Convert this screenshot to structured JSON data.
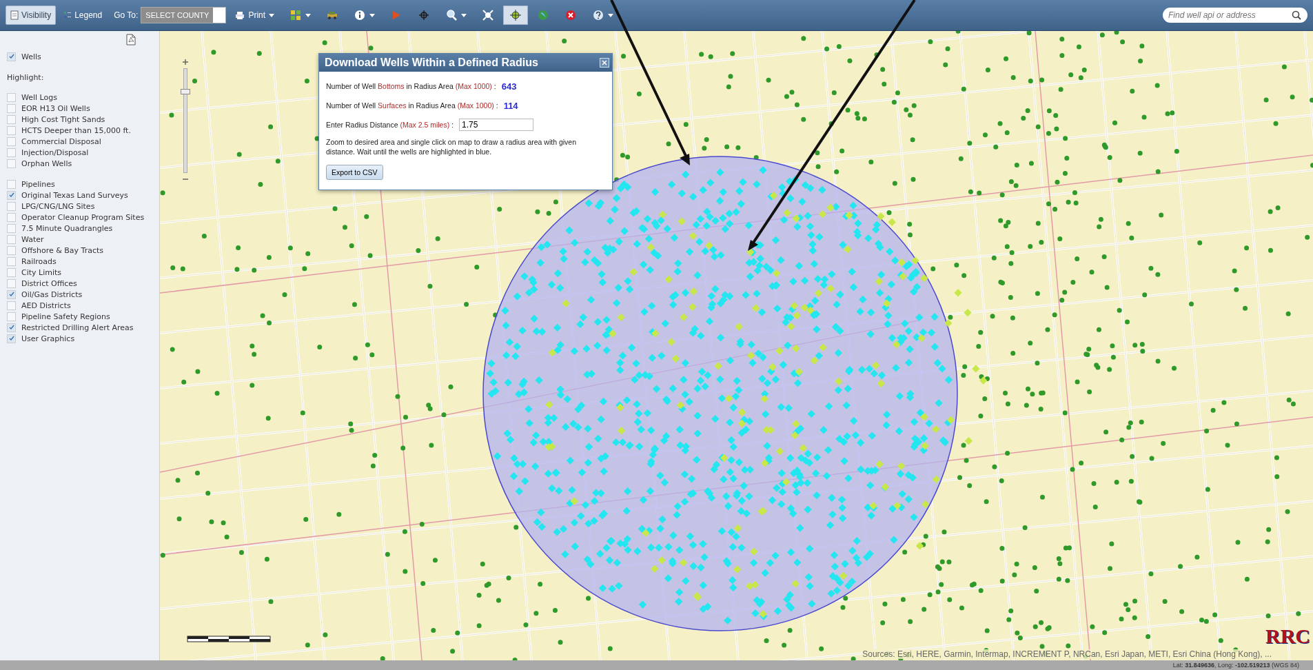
{
  "toolbar": {
    "tabs": [
      {
        "label": "Visibility",
        "selected": true
      },
      {
        "label": "Legend",
        "selected": false
      }
    ],
    "goto_label": "Go To:",
    "county_select": {
      "value": "SELECT COUNTY"
    },
    "print_button": {
      "label": "Print",
      "dropdown": true
    },
    "tools": [
      {
        "kind": "grid",
        "dropdown": true,
        "selected": false
      },
      {
        "kind": "vehicle",
        "dropdown": false,
        "selected": false
      },
      {
        "kind": "info",
        "dropdown": true,
        "selected": false
      },
      {
        "kind": "flag",
        "dropdown": false,
        "selected": false
      },
      {
        "kind": "crosshair",
        "dropdown": false,
        "selected": false
      },
      {
        "kind": "zoom",
        "dropdown": true,
        "selected": false
      },
      {
        "kind": "extent",
        "dropdown": false,
        "selected": false
      },
      {
        "kind": "locate",
        "dropdown": false,
        "selected": true
      },
      {
        "kind": "globe",
        "dropdown": false,
        "selected": false
      },
      {
        "kind": "stop",
        "dropdown": false,
        "selected": false
      },
      {
        "kind": "help",
        "dropdown": true,
        "selected": false
      }
    ],
    "search": {
      "placeholder": "Find well api or address"
    }
  },
  "sidebar": {
    "wells": {
      "label": "Wells",
      "checked": true
    },
    "highlight_label": "Highlight:",
    "highlight_items": [
      {
        "label": "Well Logs",
        "checked": false
      },
      {
        "label": "EOR H13 Oil Wells",
        "checked": false
      },
      {
        "label": "High Cost Tight Sands",
        "checked": false
      },
      {
        "label": "HCTS Deeper than 15,000 ft.",
        "checked": false
      },
      {
        "label": "Commercial Disposal",
        "checked": false
      },
      {
        "label": "Injection/Disposal",
        "checked": false
      },
      {
        "label": "Orphan Wells",
        "checked": false
      }
    ],
    "layers": [
      {
        "label": "Pipelines",
        "checked": false
      },
      {
        "label": "Original Texas Land Surveys",
        "checked": true
      },
      {
        "label": "LPG/CNG/LNG Sites",
        "checked": false
      },
      {
        "label": "Operator Cleanup Program Sites",
        "checked": false
      },
      {
        "label": "7.5 Minute Quadrangles",
        "checked": false
      },
      {
        "label": "Water",
        "checked": false
      },
      {
        "label": "Offshore & Bay Tracts",
        "checked": false
      },
      {
        "label": "Railroads",
        "checked": false
      },
      {
        "label": "City Limits",
        "checked": false
      },
      {
        "label": "District Offices",
        "checked": false
      },
      {
        "label": "Oil/Gas Districts",
        "checked": true
      },
      {
        "label": "AED Districts",
        "checked": false
      },
      {
        "label": "Pipeline Safety Regions",
        "checked": false
      },
      {
        "label": "Restricted Drilling Alert Areas",
        "checked": true
      },
      {
        "label": "User Graphics",
        "checked": true
      }
    ]
  },
  "map": {
    "zoom_slider": {
      "level": 0.78
    },
    "attribution": "Sources: Esri, HERE, Garmin, Intermap, INCREMENT P, NRCan, Esri Japan, METI, Esri China (Hong Kong), ...",
    "logo": "RRC"
  },
  "dialog": {
    "title": "Download Wells Within a Defined Radius",
    "counts": [
      {
        "parts": [
          {
            "text": "Number of Well ",
            "kind": "plain"
          },
          {
            "text": "Bottoms",
            "kind": "accent"
          },
          {
            "text": " in Radius Area ",
            "kind": "plain"
          },
          {
            "text": "(Max 1000)",
            "kind": "accent"
          },
          {
            "text": " :",
            "kind": "plain"
          }
        ],
        "value": "643"
      },
      {
        "parts": [
          {
            "text": "Number of Well ",
            "kind": "plain"
          },
          {
            "text": "Surfaces",
            "kind": "accent"
          },
          {
            "text": " in Radius Area ",
            "kind": "plain"
          },
          {
            "text": "(Max 1000)",
            "kind": "accent"
          },
          {
            "text": " :",
            "kind": "plain"
          }
        ],
        "value": "114"
      }
    ],
    "radius": {
      "parts": [
        {
          "text": "Enter Radius Distance ",
          "kind": "plain"
        },
        {
          "text": "(Max 2.5 miles)",
          "kind": "accent"
        },
        {
          "text": " :",
          "kind": "plain"
        }
      ],
      "value": "1.75"
    },
    "instructions": "Zoom to desired area and single click on map to draw a radius area with given distance. Wait until the wells are highlighted in blue.",
    "export_button": "Export to CSV"
  },
  "status_bar": {
    "coordinates": "Lat: **31.849636**, Long: **-102.519213** (WGS 84)"
  }
}
